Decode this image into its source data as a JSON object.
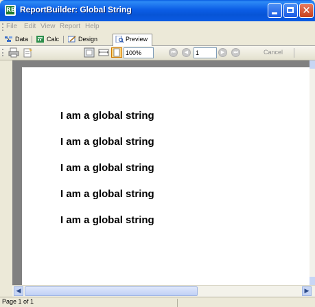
{
  "window": {
    "title": "ReportBuilder: Global String",
    "app_icon": "RB"
  },
  "menu": [
    "File",
    "Edit",
    "View",
    "Report",
    "Help"
  ],
  "tabs": [
    {
      "label": "Data",
      "icon": "data-icon"
    },
    {
      "label": "Calc",
      "icon": "calc-icon"
    },
    {
      "label": "Design",
      "icon": "design-icon"
    },
    {
      "label": "Preview",
      "icon": "preview-icon",
      "selected": true
    }
  ],
  "toolbar": {
    "zoom": "100%",
    "page": "1",
    "cancel_label": "Cancel"
  },
  "report": {
    "lines": [
      "I am a global string",
      "I am a global string",
      "I am a global string",
      "I am a global string",
      "I am a global string"
    ]
  },
  "status": {
    "text": "Page 1 of 1"
  },
  "colors": {
    "title_bar": "#0a5de2",
    "preview_background": "#808080",
    "page": "#ffffff"
  }
}
